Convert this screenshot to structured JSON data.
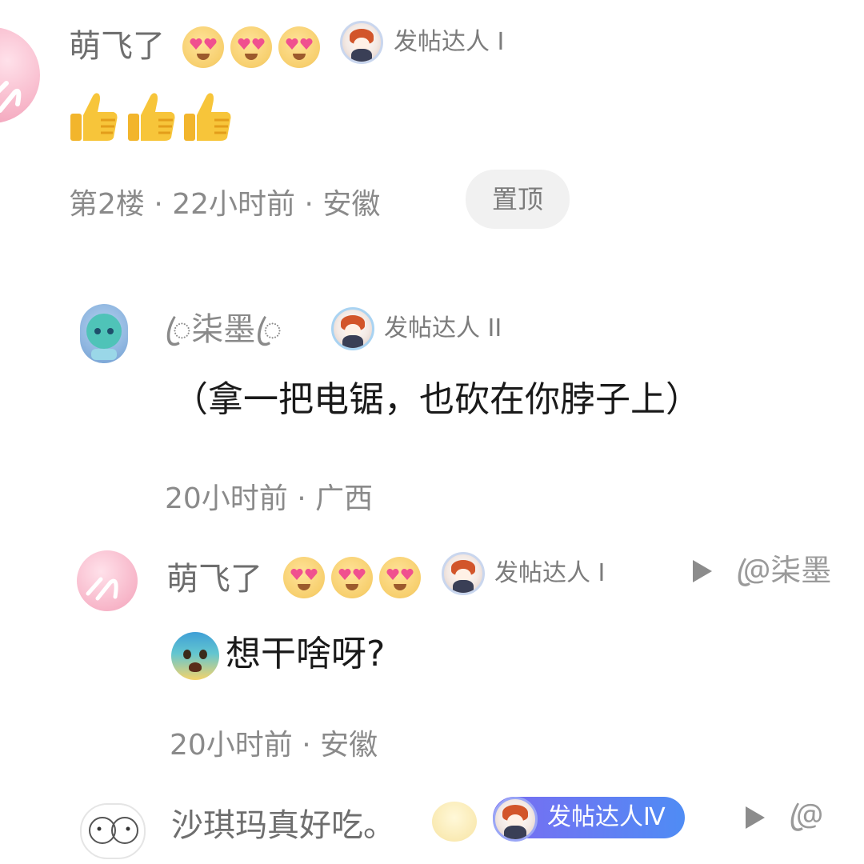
{
  "comments": [
    {
      "username": "萌飞了",
      "username_emojis": [
        "heart-eyes",
        "heart-eyes",
        "heart-eyes"
      ],
      "badge": "发帖达人 I",
      "content_emojis": [
        "thumbs-up",
        "thumbs-up",
        "thumbs-up"
      ],
      "meta": "第2楼 · 22小时前 · 安徽",
      "pin_label": "置顶"
    },
    {
      "username": "ꦿ柒墨ꦿ",
      "badge": "发帖达人 II",
      "content": "（拿一把电锯，也砍在你脖子上）",
      "meta": "20小时前 · 广西"
    },
    {
      "username": "萌飞了",
      "username_emojis": [
        "heart-eyes",
        "heart-eyes",
        "heart-eyes"
      ],
      "badge": "发帖达人 I",
      "reply_to": "@ꦿ柒墨",
      "content": "想干啥呀?",
      "content_emoji": "fearful-face",
      "meta": "20小时前 · 安徽"
    },
    {
      "username": "沙琪玛真好吃。",
      "username_emoji": "steam-face",
      "badge": "发帖达人Ⅳ",
      "reply_to": "@ꦿ"
    }
  ],
  "colors": {
    "username": "#6e6e6e",
    "content": "#1a1a1a",
    "meta": "#8a8a8a",
    "pin_bg": "#f1f1f1",
    "badge_gradient_start": "#7a6cf2",
    "badge_gradient_end": "#4f8cf4"
  }
}
